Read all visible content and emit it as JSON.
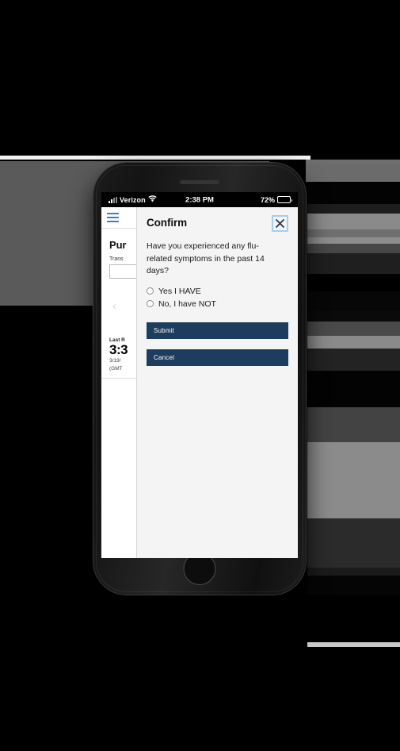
{
  "device": {
    "type": "iphone-mockup",
    "speaker_icon": "speaker-grille",
    "home_button_icon": "home-button"
  },
  "status_bar": {
    "signal_icon": "signal-bars-icon",
    "carrier": "Verizon",
    "wifi_icon": "wifi-icon",
    "time": "2:38 PM",
    "battery_percent": "72%",
    "battery_icon": "battery-icon",
    "battery_level": 72
  },
  "app_background": {
    "menu_icon": "hamburger-menu-icon",
    "heading": "Pur",
    "field_label": "Trans",
    "field_value": "",
    "prev_icon": "chevron-left-icon",
    "last_refresh_label": "Last R",
    "last_refresh_time": "3:3",
    "last_refresh_date": "3/19/",
    "last_refresh_zone": "(GMT"
  },
  "modal": {
    "title": "Confirm",
    "close_icon": "close-icon",
    "close_label": "Close",
    "question": "Have you experienced any flu-related symptoms in the past 14 days?",
    "options": [
      {
        "label": "Yes I HAVE",
        "selected": false
      },
      {
        "label": "No, I have NOT",
        "selected": false
      }
    ],
    "submit_label": "Submit",
    "cancel_label": "Cancel"
  },
  "colors": {
    "button_navy": "#1d3d5e",
    "focus_ring_blue": "#a8cdf0",
    "menu_blue": "#3d7ebf",
    "panel_gray": "#f4f4f4"
  }
}
